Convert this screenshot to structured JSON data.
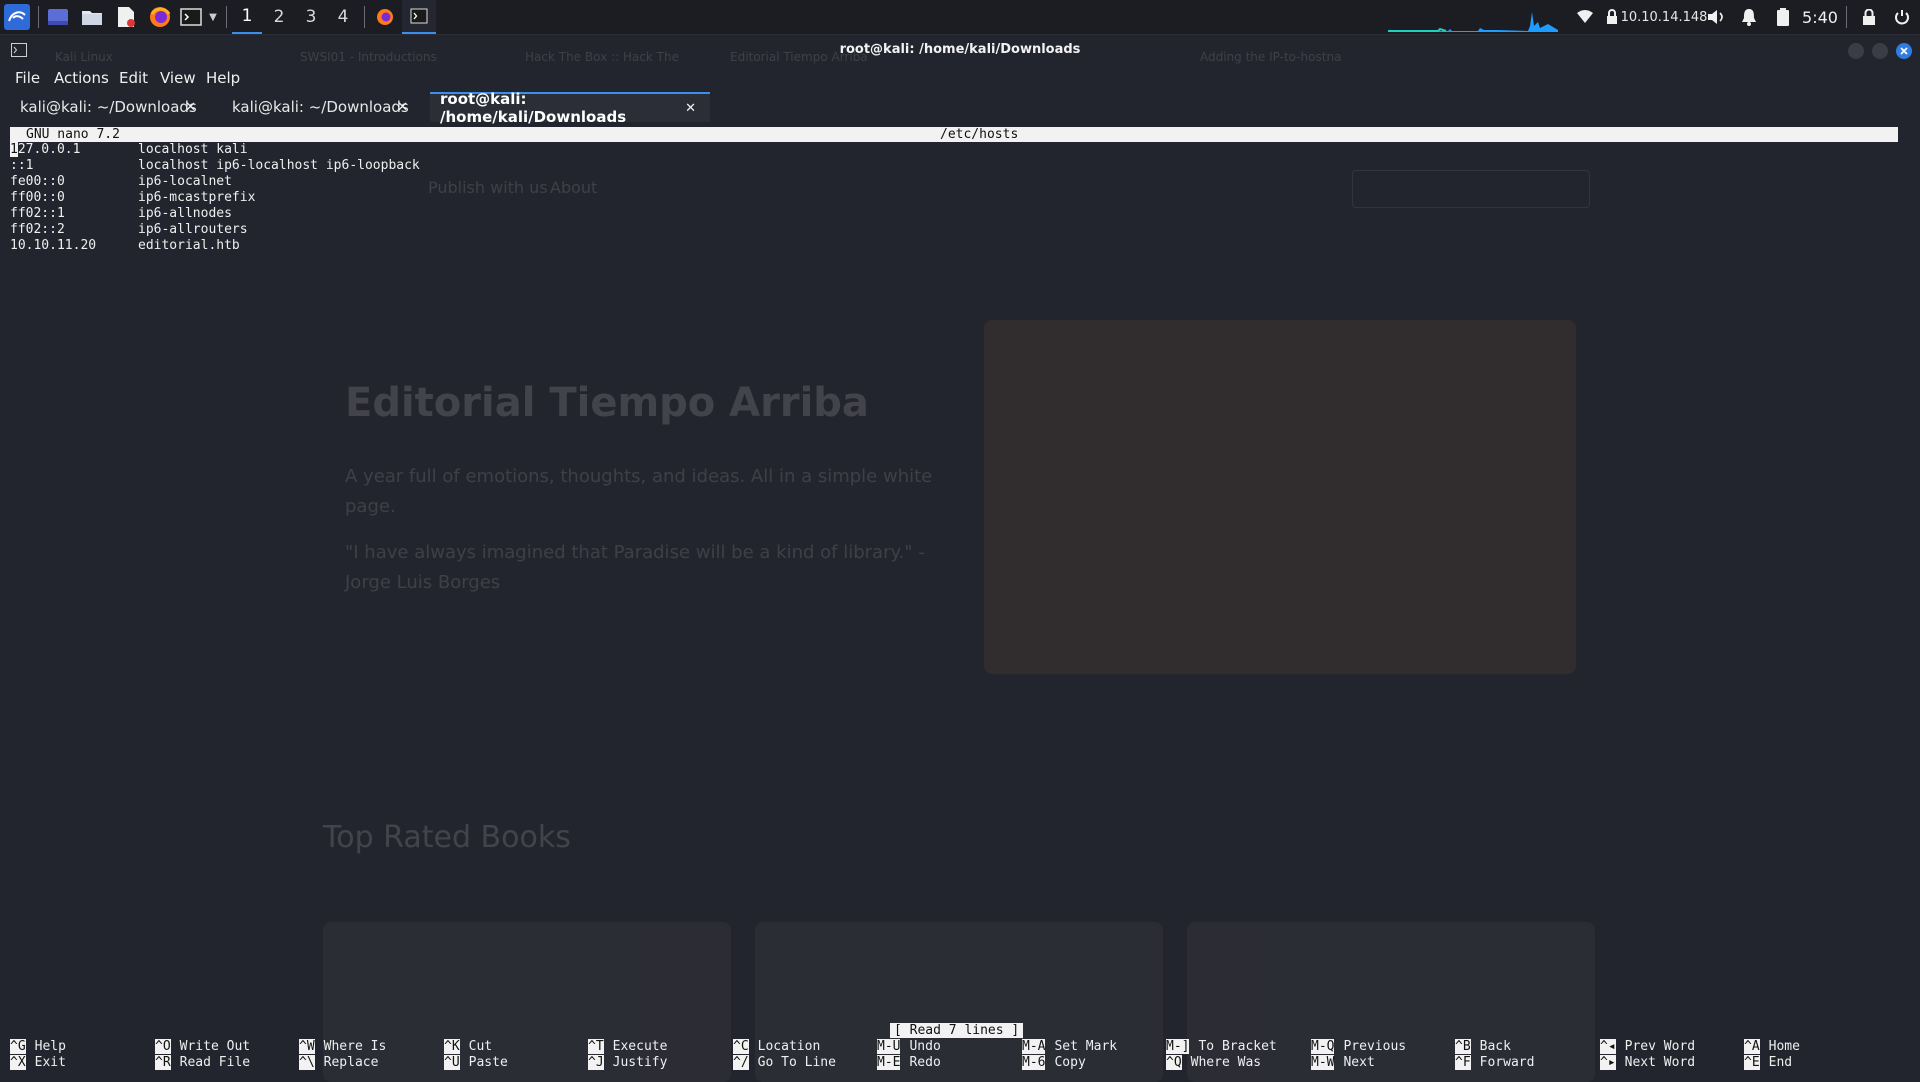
{
  "panel": {
    "workspaces": [
      "1",
      "2",
      "3",
      "4"
    ],
    "active_workspace": "1",
    "ip": "10.10.14.148",
    "clock": "5:40"
  },
  "window": {
    "title": "root@kali: /home/kali/Downloads"
  },
  "menubar": [
    "File",
    "Actions",
    "Edit",
    "View",
    "Help"
  ],
  "tabs": [
    {
      "label": "kali@kali: ~/Downloads",
      "close": "✕"
    },
    {
      "label": "kali@kali: ~/Downloads",
      "close": "✕"
    },
    {
      "label": "root@kali: /home/kali/Downloads",
      "close": "✕",
      "active": true
    }
  ],
  "nano": {
    "version": "GNU nano 7.2",
    "filename": "/etc/hosts",
    "cursor_char": "1",
    "lines": [
      {
        "addr": "27.0.0.1",
        "names": "localhost kali"
      },
      {
        "addr": "::1",
        "names": "localhost ip6-localhost ip6-loopback"
      },
      {
        "addr": "fe00::0",
        "names": "ip6-localnet"
      },
      {
        "addr": "ff00::0",
        "names": "ip6-mcastprefix"
      },
      {
        "addr": "ff02::1",
        "names": "ip6-allnodes"
      },
      {
        "addr": "ff02::2",
        "names": "ip6-allrouters"
      },
      {
        "addr": "10.10.11.20",
        "names": "editorial.htb"
      }
    ],
    "status": "[ Read 7 lines ]",
    "shortcuts": [
      [
        {
          "key": "^G",
          "label": "Help"
        },
        {
          "key": "^X",
          "label": "Exit"
        }
      ],
      [
        {
          "key": "^O",
          "label": "Write Out"
        },
        {
          "key": "^R",
          "label": "Read File"
        }
      ],
      [
        {
          "key": "^W",
          "label": "Where Is"
        },
        {
          "key": "^\\",
          "label": "Replace"
        }
      ],
      [
        {
          "key": "^K",
          "label": "Cut"
        },
        {
          "key": "^U",
          "label": "Paste"
        }
      ],
      [
        {
          "key": "^T",
          "label": "Execute"
        },
        {
          "key": "^J",
          "label": "Justify"
        }
      ],
      [
        {
          "key": "^C",
          "label": "Location"
        },
        {
          "key": "^/",
          "label": "Go To Line"
        }
      ],
      [
        {
          "key": "M-U",
          "label": "Undo"
        },
        {
          "key": "M-E",
          "label": "Redo"
        }
      ],
      [
        {
          "key": "M-A",
          "label": "Set Mark"
        },
        {
          "key": "M-6",
          "label": "Copy"
        }
      ],
      [
        {
          "key": "M-]",
          "label": "To Bracket"
        },
        {
          "key": "^Q",
          "label": "Where Was"
        }
      ],
      [
        {
          "key": "M-Q",
          "label": "Previous"
        },
        {
          "key": "M-W",
          "label": "Next"
        }
      ],
      [
        {
          "key": "^B",
          "label": "Back"
        },
        {
          "key": "^F",
          "label": "Forward"
        }
      ],
      [
        {
          "key": "^◂",
          "label": "Prev Word"
        },
        {
          "key": "^▸",
          "label": "Next Word"
        }
      ],
      [
        {
          "key": "^A",
          "label": "Home"
        },
        {
          "key": "^E",
          "label": "End"
        }
      ]
    ]
  },
  "background_browser": {
    "tabs": [
      "Kali Linux",
      "SWSI01 - Introductions",
      "Hack The Box :: Hack The",
      "Editorial Tiempo Arriba",
      "Adding the IP-to-hostna"
    ],
    "nav": [
      "Publish with us",
      "About"
    ],
    "hero_title": "Editorial Tiempo Arriba",
    "hero_text": "A year full of emotions, thoughts, and ideas. All in a simple white page.",
    "quote": "\"I have always imagined that Paradise will be a kind of library.\" - Jorge Luis Borges",
    "section_title": "Top Rated Books"
  },
  "colors": {
    "accent": "#3b8eea",
    "panel_bg": "#1b1d23",
    "terminal_bg": "#23252e",
    "nano_bar": "#f2f2f2"
  }
}
